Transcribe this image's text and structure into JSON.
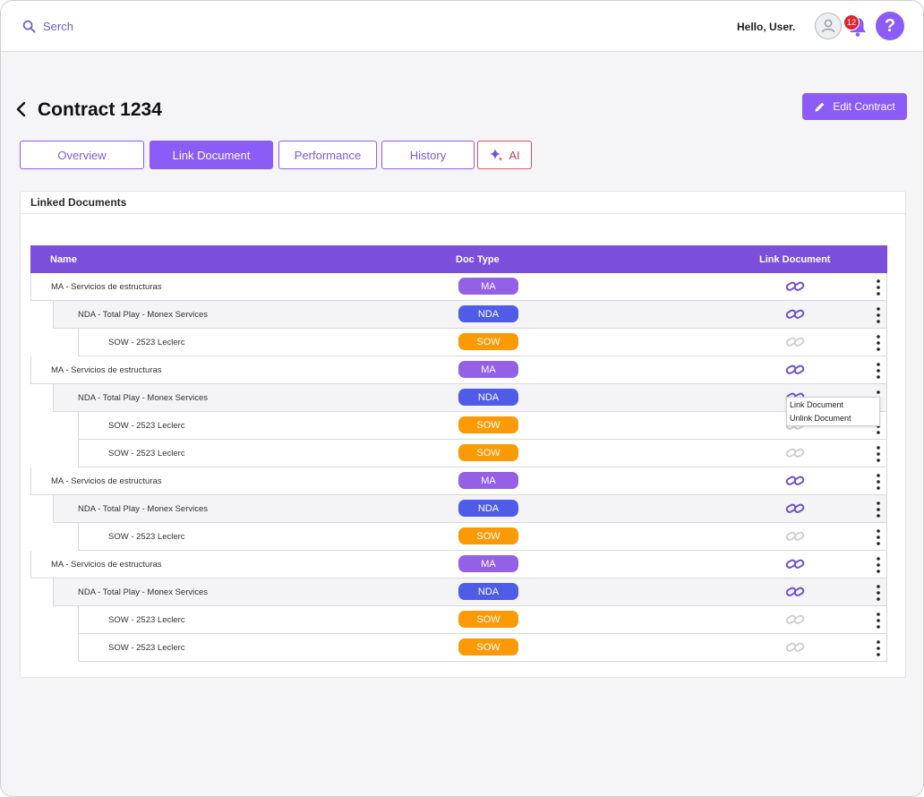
{
  "header": {
    "search_label": "Serch",
    "greeting": "Hello, User.",
    "notification_count": "12",
    "help_label": "?"
  },
  "page": {
    "title": "Contract 1234",
    "edit_label": "Edit Contract"
  },
  "tabs": [
    {
      "label": "Overview"
    },
    {
      "label": "Link Document"
    },
    {
      "label": "Performance"
    },
    {
      "label": "History"
    },
    {
      "label": "AI"
    }
  ],
  "panel": {
    "title": "Linked Documents",
    "columns": {
      "name": "Name",
      "doc_type": "Doc Type",
      "link": "Link Document"
    },
    "rows": [
      {
        "name": "MA - Servicios de estructuras",
        "type": "MA",
        "level": 1,
        "link_active": true
      },
      {
        "name": "NDA - Total Play - Monex Services",
        "type": "NDA",
        "level": 2,
        "link_active": true
      },
      {
        "name": "SOW - 2523 Leclerc",
        "type": "SOW",
        "level": 3,
        "link_active": false
      },
      {
        "name": "MA - Servicios de estructuras",
        "type": "MA",
        "level": 1,
        "link_active": true
      },
      {
        "name": "NDA - Total Play - Monex Services",
        "type": "NDA",
        "level": 2,
        "link_active": true
      },
      {
        "name": "SOW - 2523 Leclerc",
        "type": "SOW",
        "level": 3,
        "link_active": false
      },
      {
        "name": "SOW - 2523 Leclerc",
        "type": "SOW",
        "level": 3,
        "link_active": false
      },
      {
        "name": "MA - Servicios de estructuras",
        "type": "MA",
        "level": 1,
        "link_active": true
      },
      {
        "name": "NDA - Total Play - Monex Services",
        "type": "NDA",
        "level": 2,
        "link_active": true
      },
      {
        "name": "SOW - 2523 Leclerc",
        "type": "SOW",
        "level": 3,
        "link_active": false
      },
      {
        "name": "MA - Servicios de estructuras",
        "type": "MA",
        "level": 1,
        "link_active": true
      },
      {
        "name": "NDA - Total Play - Monex Services",
        "type": "NDA",
        "level": 2,
        "link_active": true
      },
      {
        "name": "SOW - 2523 Leclerc",
        "type": "SOW",
        "level": 3,
        "link_active": false
      },
      {
        "name": "SOW - 2523 Leclerc",
        "type": "SOW",
        "level": 3,
        "link_active": false
      }
    ]
  },
  "context_menu": {
    "items": [
      {
        "label": "Link Document"
      },
      {
        "label": "Unlink Document"
      }
    ]
  },
  "colors": {
    "accent": "#8b5cf6",
    "table_header": "#7b4fdc",
    "ma": "#9460e6",
    "nda": "#4f5ce8",
    "sow": "#fb9a06",
    "link_active": "#6d4fd6",
    "link_inactive": "#cfcfd4"
  },
  "icons": {
    "search": "search-icon",
    "back": "chevron-left-icon",
    "edit": "pencil-icon",
    "ai": "sparkle-icon",
    "link": "link-icon",
    "menu": "kebab-icon"
  }
}
